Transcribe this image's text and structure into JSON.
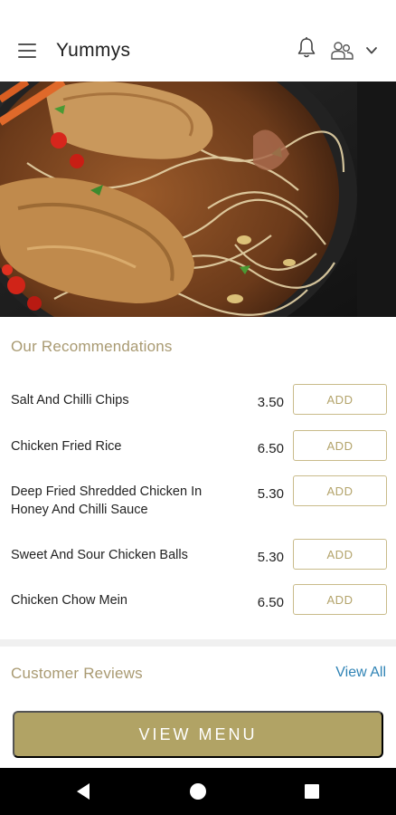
{
  "app": {
    "title": "Yummys"
  },
  "icons": {
    "menu": "hamburger-menu-icon",
    "bell": "bell-icon",
    "profile": "profile-group-icon",
    "chevron": "chevron-down-icon"
  },
  "recommendations": {
    "title": "Our Recommendations",
    "items": [
      {
        "name": "Salt And Chilli Chips",
        "price": "3.50",
        "button": "ADD"
      },
      {
        "name": "Chicken Fried Rice",
        "price": "6.50",
        "button": "ADD"
      },
      {
        "name": "Deep Fried Shredded Chicken In Honey And Chilli Sauce",
        "price": "5.30",
        "button": "ADD"
      },
      {
        "name": "Sweet And Sour Chicken Balls",
        "price": "5.30",
        "button": "ADD"
      },
      {
        "name": "Chicken Chow Mein",
        "price": "6.50",
        "button": "ADD"
      }
    ]
  },
  "reviews": {
    "title": "Customer Reviews",
    "link": "View All"
  },
  "cta": {
    "label": "VIEW MENU"
  },
  "colors": {
    "accent": "#b1a365",
    "section_title": "#a99a72",
    "link": "#2f83b5"
  }
}
